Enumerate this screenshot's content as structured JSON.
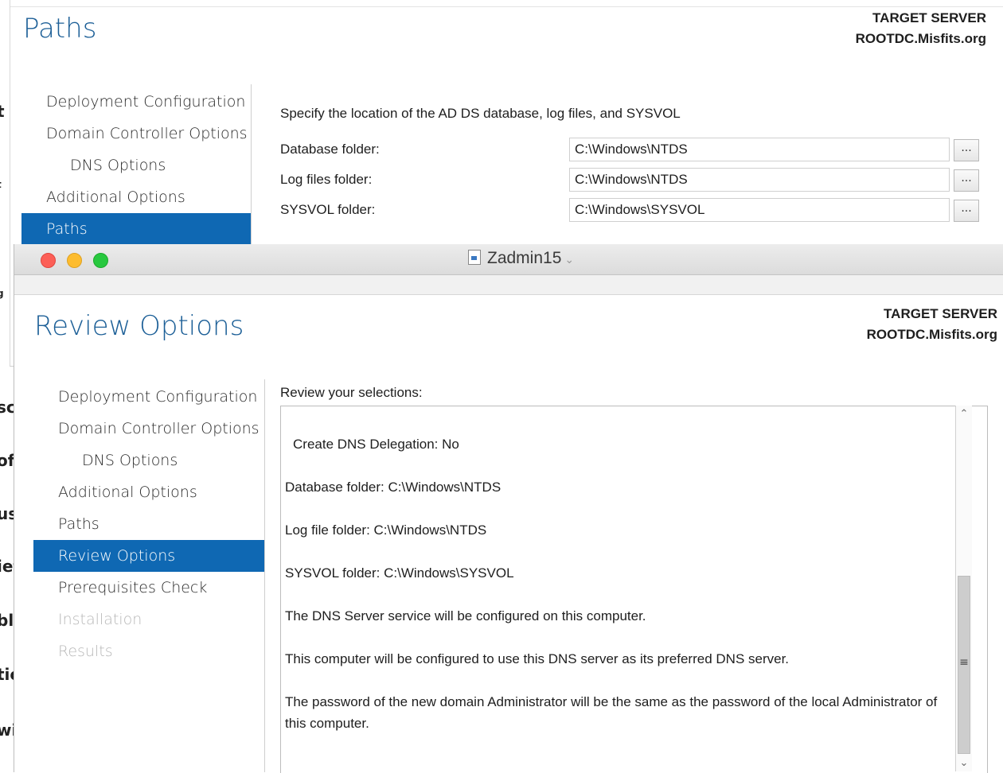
{
  "background_fragments": [
    "t",
    "t",
    "g",
    "scl",
    "of t",
    "ust",
    "ief",
    "ble",
    "tic",
    "wi"
  ],
  "paths_window": {
    "title": "Paths",
    "target_label": "TARGET SERVER",
    "target_name": "ROOTDC.Misfits.org",
    "nav": [
      {
        "label": "Deployment Configuration",
        "state": "normal"
      },
      {
        "label": "Domain Controller Options",
        "state": "normal"
      },
      {
        "label": "DNS Options",
        "state": "sub"
      },
      {
        "label": "Additional Options",
        "state": "normal"
      },
      {
        "label": "Paths",
        "state": "active"
      }
    ],
    "intro": "Specify the location of the AD DS database, log files, and SYSVOL",
    "fields": [
      {
        "label": "Database folder:",
        "value": "C:\\Windows\\NTDS"
      },
      {
        "label": "Log files folder:",
        "value": "C:\\Windows\\NTDS"
      },
      {
        "label": "SYSVOL folder:",
        "value": "C:\\Windows\\SYSVOL"
      }
    ],
    "browse_label": "..."
  },
  "front_window": {
    "window_title": "Zadmin15",
    "title": "Review Options",
    "target_label": "TARGET SERVER",
    "target_name": "ROOTDC.Misfits.org",
    "nav": [
      {
        "label": "Deployment Configuration",
        "state": "normal"
      },
      {
        "label": "Domain Controller Options",
        "state": "normal"
      },
      {
        "label": "DNS Options",
        "state": "sub"
      },
      {
        "label": "Additional Options",
        "state": "normal"
      },
      {
        "label": "Paths",
        "state": "normal"
      },
      {
        "label": "Review Options",
        "state": "active"
      },
      {
        "label": "Prerequisites Check",
        "state": "normal"
      },
      {
        "label": "Installation",
        "state": "disabled"
      },
      {
        "label": "Results",
        "state": "disabled"
      }
    ],
    "review_label": "Review your selections:",
    "review_lines": [
      " Create DNS Delegation: No",
      "Database folder: C:\\Windows\\NTDS",
      "Log file folder: C:\\Windows\\NTDS",
      "SYSVOL folder: C:\\Windows\\SYSVOL",
      "The DNS Server service will be configured on this computer.",
      "This computer will be configured to use this DNS server as its preferred DNS server.",
      "The password of the new domain Administrator will be the same as the password of the local Administrator of this computer."
    ]
  },
  "icons": {
    "close": "close-icon",
    "minimize": "minimize-icon",
    "maximize": "maximize-icon",
    "document": "document-icon",
    "chevron": "chevron-down-icon",
    "scroll_up": "chevron-up-icon",
    "scroll_down": "chevron-down-icon",
    "grip": "grip-icon"
  },
  "colors": {
    "accent": "#0f68b3",
    "title": "#1c5f97",
    "disabled": "#b8b8b8"
  }
}
